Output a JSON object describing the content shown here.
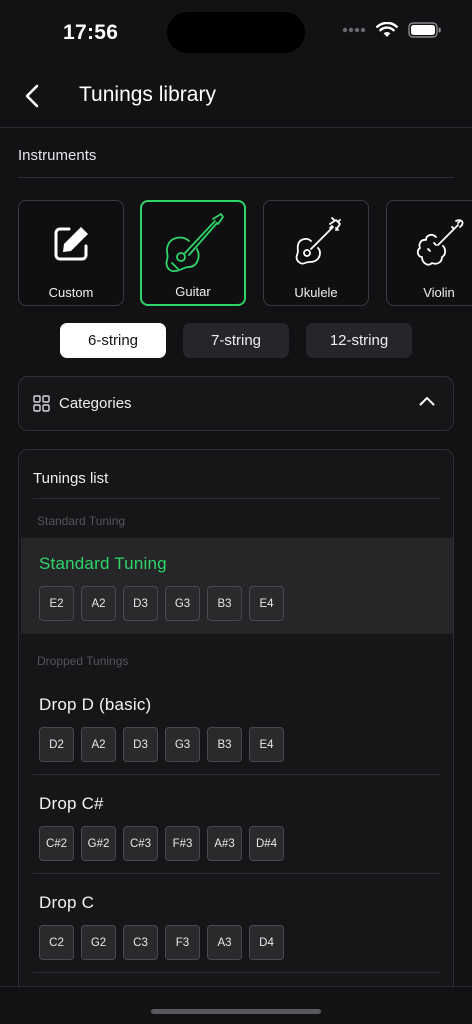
{
  "status": {
    "time": "17:56"
  },
  "header": {
    "title": "Tunings library"
  },
  "instruments": {
    "label": "Instruments",
    "items": [
      {
        "label": "Custom",
        "icon": "edit-icon",
        "active": false
      },
      {
        "label": "Guitar",
        "icon": "guitar-icon",
        "active": true
      },
      {
        "label": "Ukulele",
        "icon": "ukulele-icon",
        "active": false
      },
      {
        "label": "Violin",
        "icon": "violin-icon",
        "active": false
      }
    ]
  },
  "variants": [
    {
      "label": "6-string",
      "active": true
    },
    {
      "label": "7-string",
      "active": false
    },
    {
      "label": "12-string",
      "active": false
    }
  ],
  "categories": {
    "label": "Categories"
  },
  "tunings": {
    "title": "Tunings list",
    "groups": [
      {
        "label": "Standard Tuning",
        "items": [
          {
            "name": "Standard Tuning",
            "selected": true,
            "notes": [
              "E2",
              "A2",
              "D3",
              "G3",
              "B3",
              "E4"
            ]
          }
        ]
      },
      {
        "label": "Dropped Tunings",
        "items": [
          {
            "name": "Drop D (basic)",
            "selected": false,
            "notes": [
              "D2",
              "A2",
              "D3",
              "G3",
              "B3",
              "E4"
            ]
          },
          {
            "name": "Drop C#",
            "selected": false,
            "notes": [
              "C#2",
              "G#2",
              "C#3",
              "F#3",
              "A#3",
              "D#4"
            ]
          },
          {
            "name": "Drop C",
            "selected": false,
            "notes": [
              "C2",
              "G2",
              "C3",
              "F3",
              "A3",
              "D4"
            ]
          }
        ]
      }
    ]
  },
  "colors": {
    "accent": "#2fd46a",
    "background": "#121214",
    "panel": "#161618"
  }
}
